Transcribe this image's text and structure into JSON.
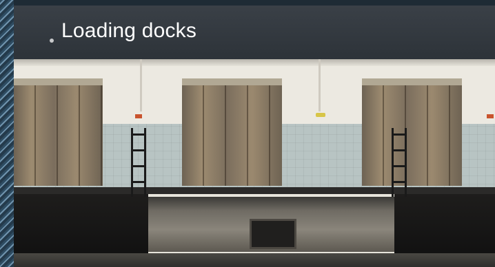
{
  "card": {
    "title": "Loading docks"
  },
  "colors": {
    "card_background": "#2b3136",
    "title_text": "#ffffff",
    "page_background": "#1e2b35"
  },
  "photo": {
    "subject": "loading-dock-photo"
  }
}
